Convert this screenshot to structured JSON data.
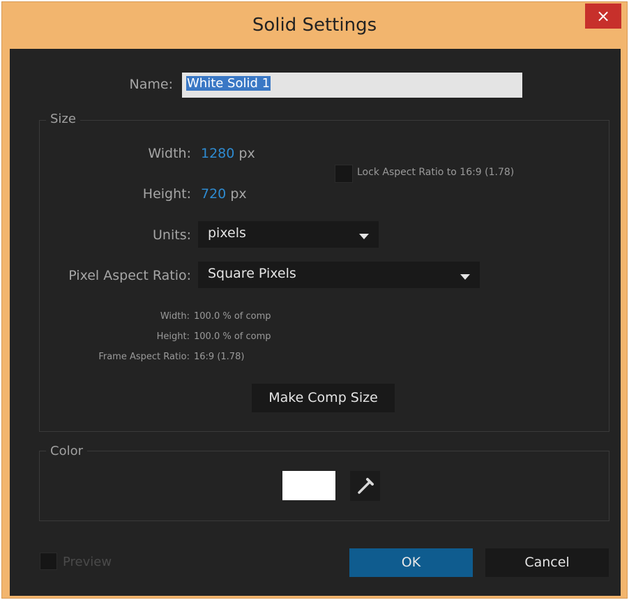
{
  "window": {
    "title": "Solid Settings",
    "close_glyph": "×"
  },
  "name": {
    "label": "Name:",
    "value": "White Solid 1"
  },
  "size": {
    "group_label": "Size",
    "width_label": "Width:",
    "width_value": "1280",
    "width_unit": "px",
    "height_label": "Height:",
    "height_value": "720",
    "height_unit": "px",
    "lock_label": "Lock Aspect Ratio to 16:9 (1.78)",
    "lock_checked": false,
    "units_label": "Units:",
    "units_value": "pixels",
    "par_label": "Pixel Aspect Ratio:",
    "par_value": "Square Pixels",
    "info": [
      {
        "label": "Width:",
        "value": "100.0 % of comp"
      },
      {
        "label": "Height:",
        "value": "100.0 % of comp"
      },
      {
        "label": "Frame Aspect Ratio:",
        "value": "16:9 (1.78)"
      }
    ],
    "make_comp_size": "Make Comp Size"
  },
  "color": {
    "group_label": "Color",
    "swatch_color": "#ffffff",
    "eyedropper_icon": "eyedropper-icon"
  },
  "footer": {
    "preview_label": "Preview",
    "preview_checked": false,
    "ok_label": "OK",
    "cancel_label": "Cancel"
  },
  "theme": {
    "accent": "#0f5c8f",
    "value_blue": "#2e8bd1",
    "titlebar": "#f2b56e",
    "close": "#c7302b"
  }
}
